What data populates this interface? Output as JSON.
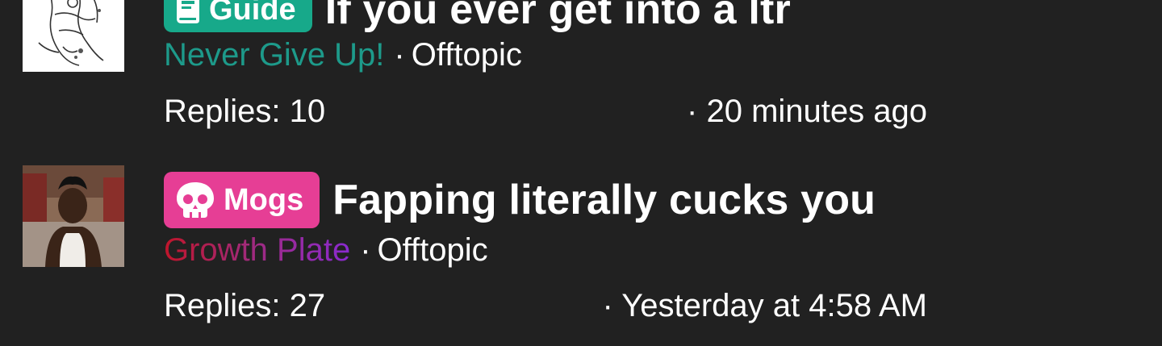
{
  "threads": [
    {
      "prefix": {
        "label": "Guide",
        "icon": "book-icon",
        "color": "#17a98a"
      },
      "title": "If you ever get into a ltr",
      "author": {
        "name": "Never Give Up!",
        "color": "#1d9a8a"
      },
      "separator": "·",
      "forum": "Offtopic",
      "replies_label": "Replies: 10",
      "date": "· 20 minutes ago"
    },
    {
      "prefix": {
        "label": "Mogs",
        "icon": "skull-icon",
        "color": "#e63e95"
      },
      "title": "Fapping literally cucks you",
      "author": {
        "name": "Growth Plate",
        "color": "gradient-red-purple"
      },
      "separator": "·",
      "forum": "Offtopic",
      "replies_label": "Replies: 27",
      "date": "· Yesterday at 4:58 AM"
    }
  ]
}
